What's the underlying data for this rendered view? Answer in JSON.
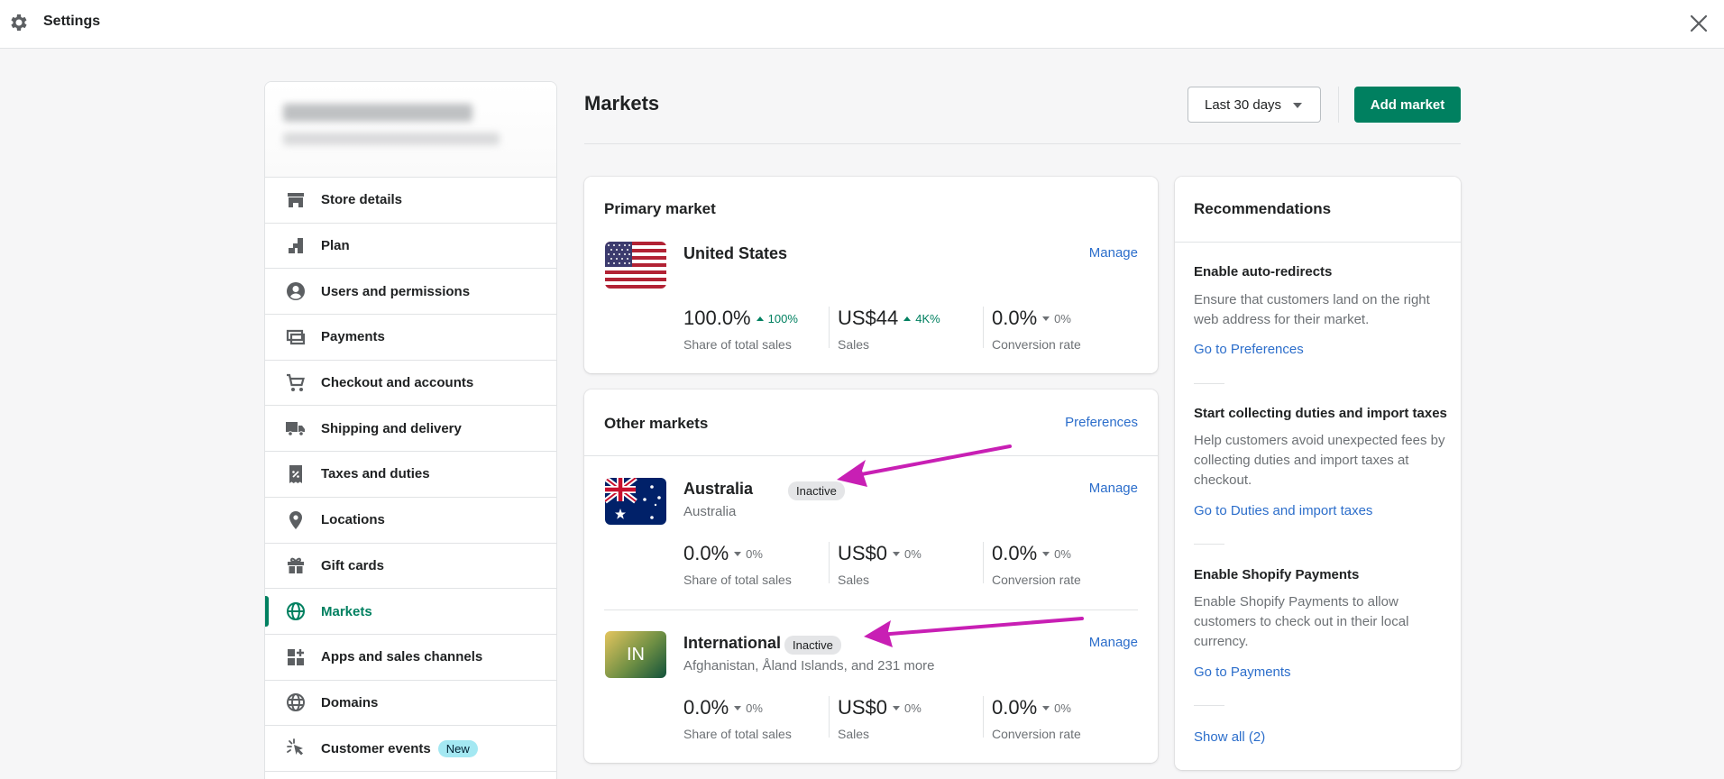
{
  "topbar": {
    "title": "Settings"
  },
  "sidebar": {
    "items": [
      {
        "label": "Store details",
        "icon": "store-icon"
      },
      {
        "label": "Plan",
        "icon": "plan-icon"
      },
      {
        "label": "Users and permissions",
        "icon": "user-icon"
      },
      {
        "label": "Payments",
        "icon": "payments-icon"
      },
      {
        "label": "Checkout and accounts",
        "icon": "cart-icon"
      },
      {
        "label": "Shipping and delivery",
        "icon": "truck-icon"
      },
      {
        "label": "Taxes and duties",
        "icon": "receipt-icon"
      },
      {
        "label": "Locations",
        "icon": "location-icon"
      },
      {
        "label": "Gift cards",
        "icon": "gift-icon"
      },
      {
        "label": "Markets",
        "icon": "globe-icon",
        "active": true
      },
      {
        "label": "Apps and sales channels",
        "icon": "apps-icon"
      },
      {
        "label": "Domains",
        "icon": "domains-icon"
      },
      {
        "label": "Customer events",
        "icon": "cursor-icon",
        "badge": "New"
      }
    ]
  },
  "header": {
    "title": "Markets",
    "date_range": "Last 30 days",
    "add_label": "Add market"
  },
  "primary": {
    "title": "Primary market",
    "name": "United States",
    "manage": "Manage",
    "metrics": [
      {
        "value": "100.0%",
        "change": "100%",
        "label": "Share of total sales",
        "trend": "up"
      },
      {
        "value": "US$44",
        "change": "4K%",
        "label": "Sales",
        "trend": "up"
      },
      {
        "value": "0.0%",
        "change": "0%",
        "label": "Conversion rate",
        "trend": "down"
      }
    ]
  },
  "other": {
    "title": "Other markets",
    "preferences": "Preferences",
    "markets": [
      {
        "name": "Australia",
        "status": "Inactive",
        "sub": "Australia",
        "manage": "Manage",
        "metrics": [
          {
            "value": "0.0%",
            "change": "0%",
            "label": "Share of total sales"
          },
          {
            "value": "US$0",
            "change": "0%",
            "label": "Sales"
          },
          {
            "value": "0.0%",
            "change": "0%",
            "label": "Conversion rate"
          }
        ]
      },
      {
        "name": "International",
        "status": "Inactive",
        "sub": "Afghanistan, Åland Islands, and 231 more",
        "manage": "Manage",
        "flag_text": "IN",
        "metrics": [
          {
            "value": "0.0%",
            "change": "0%",
            "label": "Share of total sales"
          },
          {
            "value": "US$0",
            "change": "0%",
            "label": "Sales"
          },
          {
            "value": "0.0%",
            "change": "0%",
            "label": "Conversion rate"
          }
        ]
      }
    ]
  },
  "recommendations": {
    "title": "Recommendations",
    "items": [
      {
        "heading": "Enable auto-redirects",
        "body": "Ensure that customers land on the right web address for their market.",
        "link": "Go to Preferences"
      },
      {
        "heading": "Start collecting duties and import taxes",
        "body": "Help customers avoid unexpected fees by collecting duties and import taxes at checkout.",
        "link": "Go to Duties and import taxes"
      },
      {
        "heading": "Enable Shopify Payments",
        "body": "Enable Shopify Payments to allow customers to check out in their local currency.",
        "link": "Go to Payments"
      }
    ],
    "show_all": "Show all (2)"
  },
  "colors": {
    "accent": "#008060",
    "link": "#2c6ecb",
    "arrow": "#c81fb4"
  }
}
